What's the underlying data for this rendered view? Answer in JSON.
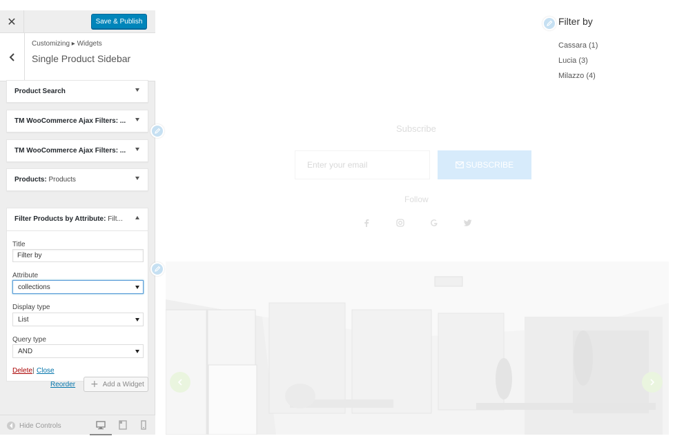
{
  "topbar": {
    "close_glyph": "✕",
    "save_label": "Save & Publish"
  },
  "header": {
    "back_glyph": "‹",
    "breadcrumb": "Customizing ▸ Widgets",
    "title": "Single Product Sidebar"
  },
  "widgets": [
    {
      "label": "Product Search",
      "sub": ""
    },
    {
      "label": "TM WooCommerce Ajax Filters: ...",
      "sub": ""
    },
    {
      "label": "TM WooCommerce Ajax Filters: ...",
      "sub": ""
    },
    {
      "label": "Products:",
      "sub": " Products"
    }
  ],
  "open_widget": {
    "label": "Filter Products by Attribute:",
    "sub": " Filt...",
    "title_label": "Title",
    "title_value": "Filter by",
    "attribute_label": "Attribute",
    "attribute_value": "collections",
    "display_label": "Display type",
    "display_value": "List",
    "query_label": "Query type",
    "query_value": "AND",
    "delete_label": "Delete",
    "separator": "|",
    "close_label": "Close"
  },
  "actions": {
    "reorder_label": "Reorder",
    "add_widget_label": "Add a Widget",
    "add_glyph": "+"
  },
  "footer": {
    "hide_controls_label": "Hide Controls"
  },
  "preview": {
    "filter_title": "Filter by",
    "filter_items": [
      "Cassara (1)",
      "Lucia (3)",
      "Milazzo (4)"
    ],
    "subscribe_title": "Subscribe",
    "email_placeholder": "Enter your email",
    "subscribe_button": "SUBSCRIBE",
    "follow_title": "Follow",
    "social_icons": [
      "facebook-icon",
      "instagram-icon",
      "google-icon",
      "twitter-icon"
    ]
  },
  "colors": {
    "primary_button": "#0085ba",
    "link": "#0073aa",
    "delete_link": "#aa0000",
    "subscribe_button_bg": "#d7ebfb",
    "edit_shortcut": "#c6e0f2"
  }
}
